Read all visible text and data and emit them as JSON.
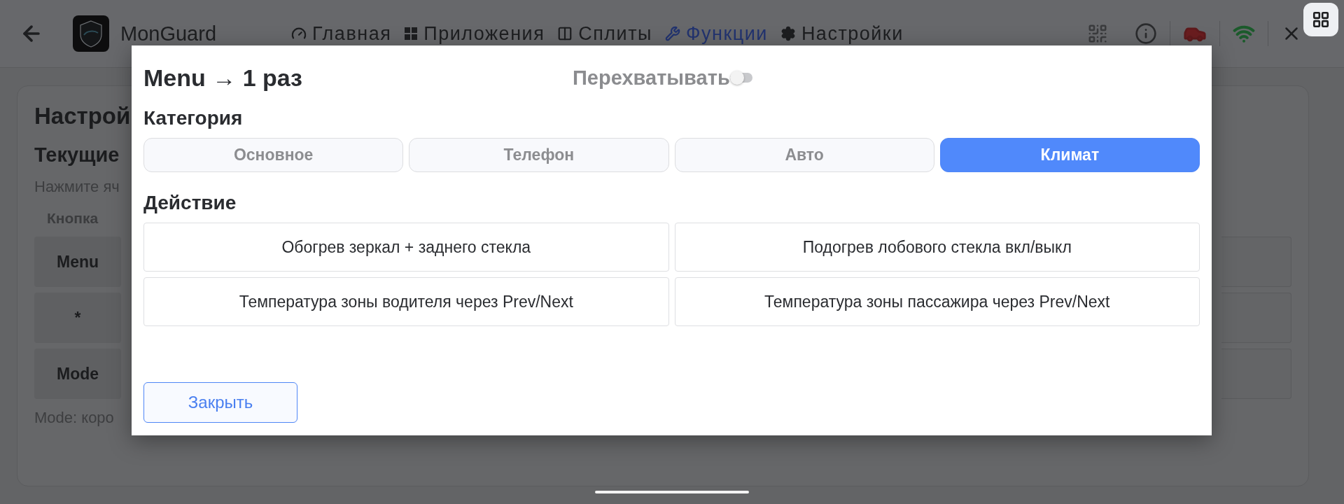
{
  "top_bar": {
    "title": "MonGuard",
    "nav": [
      {
        "label": "Главная",
        "kind": "gauge",
        "selected": false
      },
      {
        "label": "Приложения",
        "kind": "squares",
        "selected": false
      },
      {
        "label": "Сплиты",
        "kind": "columns",
        "selected": false
      },
      {
        "label": "Функции",
        "kind": "wrench",
        "selected": true
      },
      {
        "label": "Настройки",
        "kind": "gear",
        "selected": false
      }
    ]
  },
  "page": {
    "title": "Настрой",
    "subtitle": "Текущие",
    "hint": "Нажмите яч",
    "column_1": "Кнопка",
    "rows": [
      {
        "button": "Menu"
      },
      {
        "button": "*"
      },
      {
        "button": "Mode"
      }
    ],
    "note": "Mode: коро"
  },
  "dialog": {
    "title": "Menu → 1 раз",
    "intercept": {
      "label": "Перехватывать",
      "on": false
    },
    "category_label": "Категория",
    "categories": [
      {
        "label": "Основное",
        "selected": false
      },
      {
        "label": "Телефон",
        "selected": false
      },
      {
        "label": "Авто",
        "selected": false
      },
      {
        "label": "Климат",
        "selected": true
      }
    ],
    "action_label": "Действие",
    "actions": [
      "Обогрев зеркал + заднего стекла",
      "Подогрев лобового стекла вкл/выкл",
      "Температура зоны водителя через Prev/Next",
      "Температура зоны пассажира через Prev/Next"
    ],
    "close": "Закрыть"
  }
}
